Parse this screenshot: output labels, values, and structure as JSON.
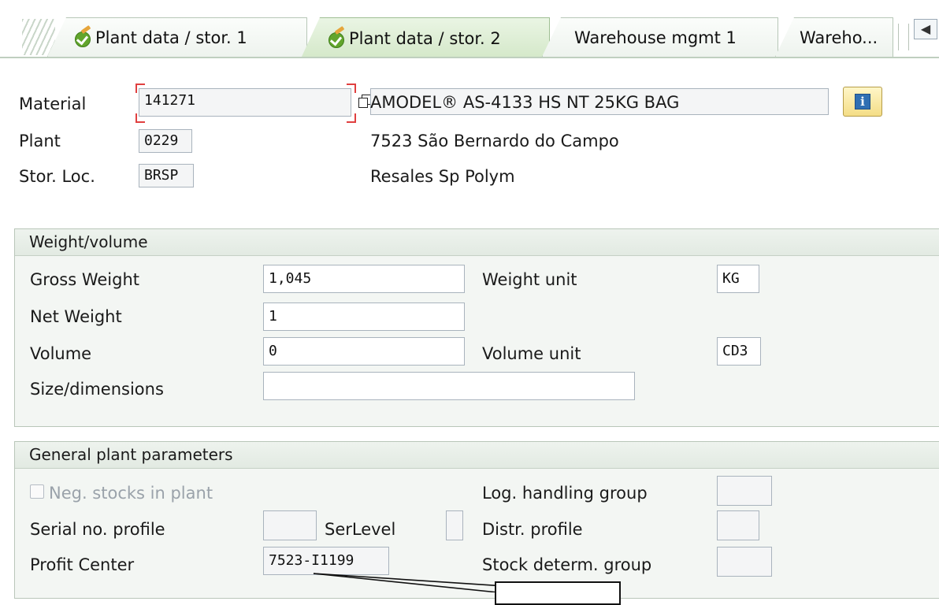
{
  "tabs": [
    {
      "label": "Plant data / stor. 1",
      "status_icon": "check-pencil-icon"
    },
    {
      "label": "Plant data / stor. 2",
      "status_icon": "check-pencil-icon",
      "active": true
    },
    {
      "label": "Warehouse mgmt 1"
    },
    {
      "label": "Wareho..."
    }
  ],
  "tab_scroll_glyph": "◀",
  "header": {
    "material_label": "Material",
    "material_value": "141271",
    "material_desc": "AMODEL® AS-4133 HS NT 25KG BAG",
    "plant_label": "Plant",
    "plant_value": "0229",
    "plant_desc": "7523 São Bernardo do Campo",
    "storloc_label": "Stor. Loc.",
    "storloc_value": "BRSP",
    "storloc_desc": "Resales Sp Polym",
    "info_glyph": "i"
  },
  "weight_volume": {
    "title": "Weight/volume",
    "gross_weight_label": "Gross Weight",
    "gross_weight_value": "1,045",
    "weight_unit_label": "Weight unit",
    "weight_unit_value": "KG",
    "net_weight_label": "Net Weight",
    "net_weight_value": "1",
    "volume_label": "Volume",
    "volume_value": "0",
    "volume_unit_label": "Volume unit",
    "volume_unit_value": "CD3",
    "size_label": "Size/dimensions",
    "size_value": ""
  },
  "general_plant": {
    "title": "General plant parameters",
    "neg_stocks_label": "Neg. stocks in plant",
    "log_handling_label": "Log. handling group",
    "serial_profile_label": "Serial no. profile",
    "serlevel_label": "SerLevel",
    "distr_profile_label": "Distr. profile",
    "profit_center_label": "Profit Center",
    "profit_center_value": "7523-I1199",
    "stock_determ_label": "Stock determ. group"
  },
  "colors": {
    "active_tab": "#d4e8c9",
    "group_bg": "#f3f6f3",
    "focus_mark": "#e04040",
    "info_button": "#f4dd86"
  }
}
